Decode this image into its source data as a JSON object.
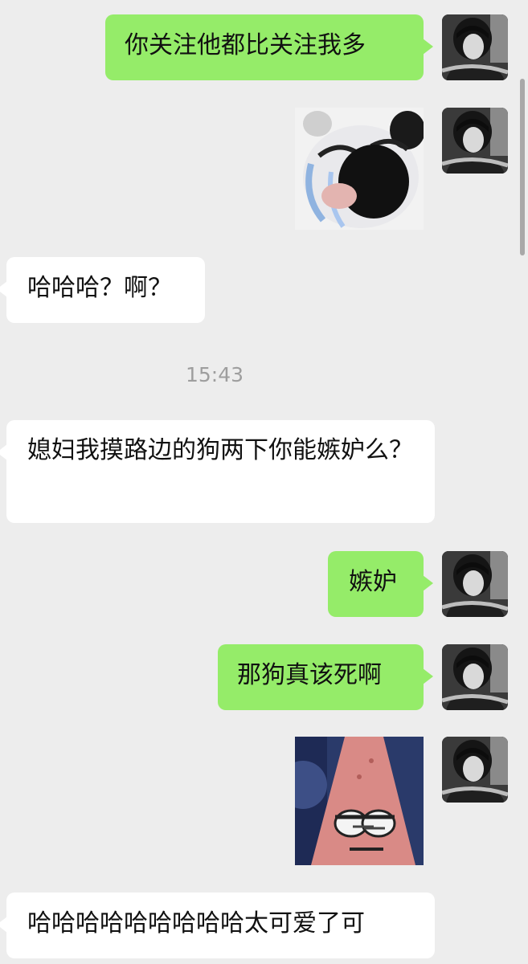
{
  "chat": {
    "messages": [
      {
        "text": "你关注他都比关注我多"
      },
      {
        "sticker": "crying-panda-meme"
      },
      {
        "text": "哈哈哈？啊？"
      },
      {
        "text": "媳妇我摸路边的狗两下你能嫉妒么？"
      },
      {
        "text": "嫉妒"
      },
      {
        "text": "那狗真该死啊"
      },
      {
        "sticker": "patrick-star-meme"
      },
      {
        "text": "哈哈哈哈哈哈哈哈哈太可爱了可"
      }
    ],
    "timestamp": "15:43"
  },
  "colors": {
    "background": "#ededed",
    "outgoing_bubble": "#95ec69",
    "incoming_bubble": "#ffffff",
    "timestamp_text": "#9e9e9e"
  },
  "icons": {
    "avatar": "user-avatar-icon",
    "sticker_1": "crying-panda-meme",
    "sticker_2": "patrick-star-meme"
  }
}
